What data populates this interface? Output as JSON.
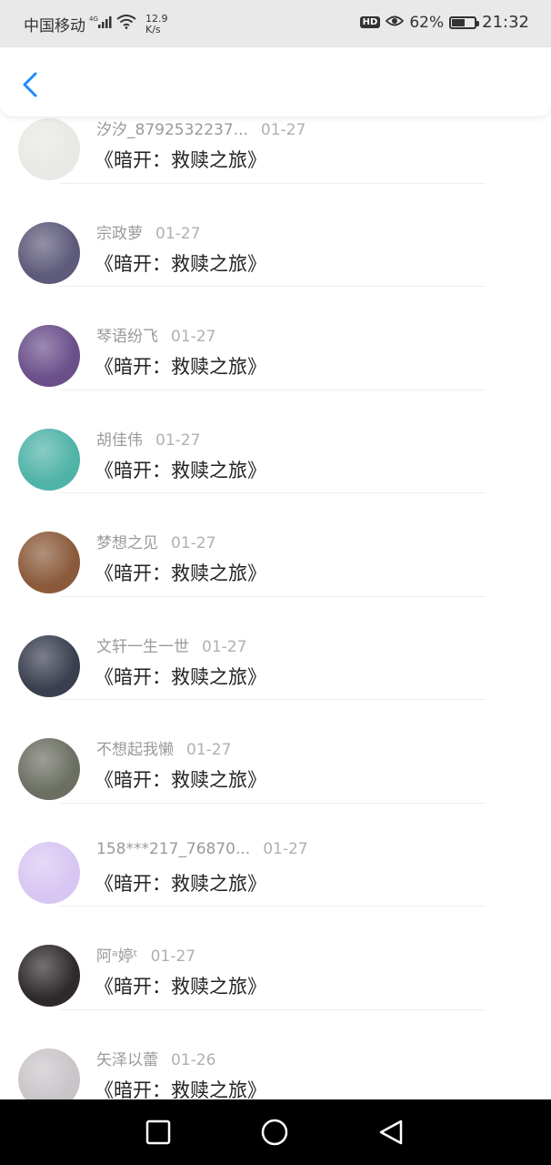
{
  "status_bar": {
    "carrier": "中国移动",
    "network": "4G",
    "speed_value": "12.9",
    "speed_unit": "K/s",
    "hd": "HD",
    "battery_percent": "62%",
    "battery_level": 0.62,
    "time": "21:32"
  },
  "items": [
    {
      "user": "汐汐_8792532237...",
      "date": "01-27",
      "title": "《暗开：救赎之旅》",
      "avatar_color": "#e8e8e4"
    },
    {
      "user": "宗政萝",
      "date": "01-27",
      "title": "《暗开：救赎之旅》",
      "avatar_color": "#5d5a7a"
    },
    {
      "user": "琴语纷飞",
      "date": "01-27",
      "title": "《暗开：救赎之旅》",
      "avatar_color": "#6a4f8a"
    },
    {
      "user": "胡佳伟",
      "date": "01-27",
      "title": "《暗开：救赎之旅》",
      "avatar_color": "#4fb3a8"
    },
    {
      "user": "梦想之见",
      "date": "01-27",
      "title": "《暗开：救赎之旅》",
      "avatar_color": "#8a5a3a"
    },
    {
      "user": "文轩一生一世",
      "date": "01-27",
      "title": "《暗开：救赎之旅》",
      "avatar_color": "#3a3f4f"
    },
    {
      "user": "不想起我懒",
      "date": "01-27",
      "title": "《暗开：救赎之旅》",
      "avatar_color": "#6b6f62"
    },
    {
      "user": "158***217_76870...",
      "date": "01-27",
      "title": "《暗开：救赎之旅》",
      "avatar_color": "#d8c6f2"
    },
    {
      "user": "阿ᵃ婷ᵗ",
      "date": "01-27",
      "title": "《暗开：救赎之旅》",
      "avatar_color": "#2e2a2b"
    },
    {
      "user": "矢泽以蕾",
      "date": "01-26",
      "title": "《暗开：救赎之旅》",
      "avatar_color": "#c9c4c8"
    }
  ],
  "colors": {
    "accent": "#1a8cff",
    "status_bar_bg": "#e9e9e9",
    "nav_bar_bg": "#000000"
  }
}
